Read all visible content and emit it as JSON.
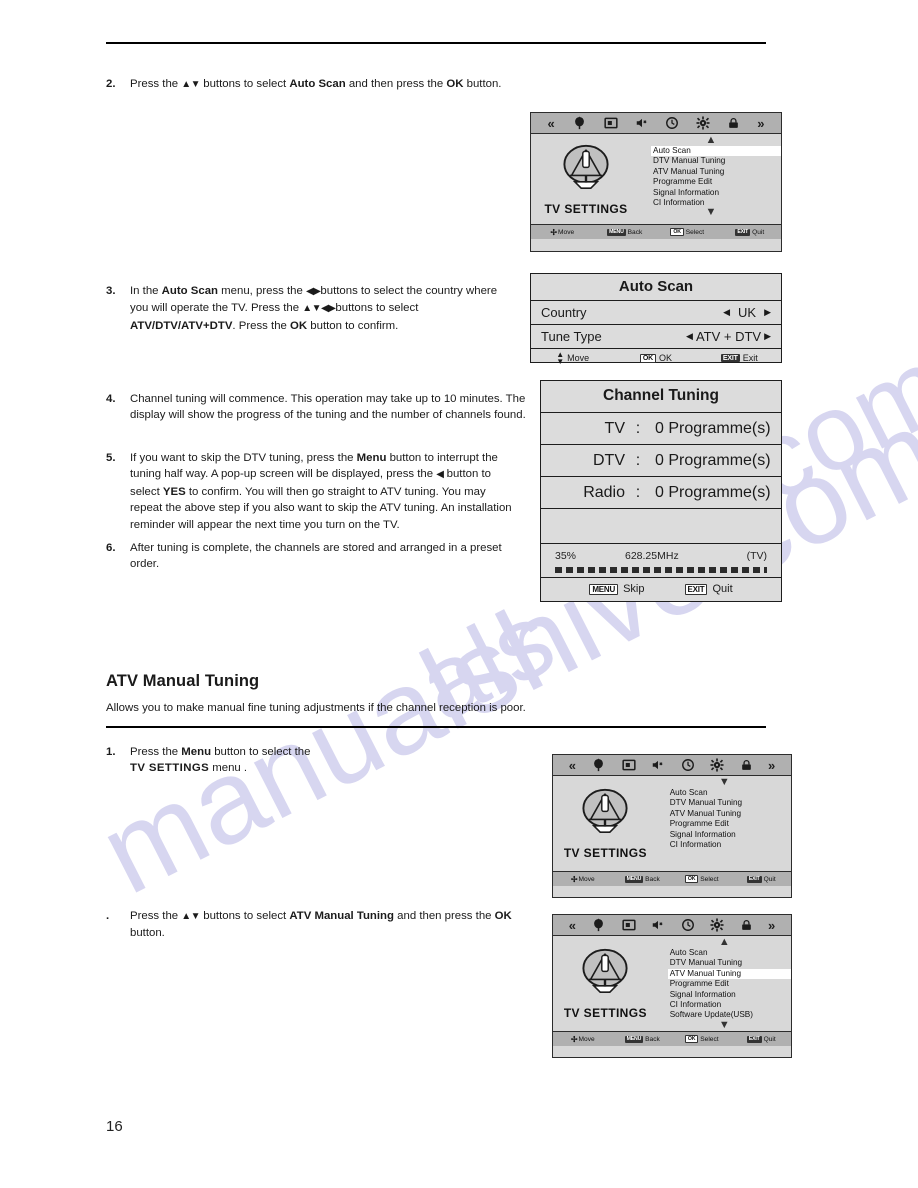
{
  "page": {
    "number": "16"
  },
  "watermark": {
    "line1": "manualshive.com",
    "line2": "ve.com",
    "line3": "als"
  },
  "steps": {
    "s2": {
      "num": "2.",
      "html_parts": {
        "p1": "Press the ",
        "arrows1": "▲▼",
        "p2": " buttons to select ",
        "b1": "Auto Scan",
        "p3": " and then press the ",
        "b2": "OK",
        "p4": " button."
      }
    },
    "s3": {
      "num": "3.",
      "html_parts": {
        "p1": "In the ",
        "b1": "Auto  Scan",
        "p2": " menu, press the ",
        "arrows1": "◀▶",
        "p3": "buttons to select the country where you will operate the TV. Press the ",
        "arrows2": "▲▼◀▶",
        "p4": "buttons to select ",
        "b2": "ATV/DTV/ATV+DTV",
        "p5": ". Press the ",
        "b3": "OK",
        "p6": " button to confirm."
      }
    },
    "s4": {
      "num": "4.",
      "text": "Channel tuning will commence. This operation may take up to 10 minutes. The display will show the progress of the tuning and the number of channels found."
    },
    "s5": {
      "num": "5.",
      "html_parts": {
        "p1": "If you want to skip the DTV tuning, press the ",
        "b1": "Menu",
        "p2": " button to interrupt the tuning half way. A pop-up screen will be displayed, press the ",
        "arrows1": "◀",
        "p3": " button to select ",
        "b2": "YES",
        "p4": " to confirm. You will then go straight to ATV tuning. You may repeat the above step if you also want to skip the ATV tuning. An installation reminder will appear the next time you turn on the TV."
      }
    },
    "s6": {
      "num": "6.",
      "text": "After tuning is complete, the channels are stored and arranged in a preset order."
    },
    "a1": {
      "num": "1.",
      "html_parts": {
        "p1": "Press the ",
        "b1": "Menu",
        "p2": " button to select the ",
        "b2": "TV SETTINGS",
        "p3": " menu ."
      }
    },
    "a2": {
      "num": ".",
      "html_parts": {
        "p1": "Press the ",
        "arrows1": "▲▼",
        "p2": " buttons to select ",
        "b1": "ATV Manual Tuning",
        "p3": " and then press the ",
        "b2": "OK",
        "p4": " button."
      }
    }
  },
  "section": {
    "title": "ATV Manual Tuning",
    "description": "Allows you to make manual fine tuning adjustments if the channel reception is poor."
  },
  "osd_common": {
    "brand": "TV SETTINGS",
    "icons": [
      "chevron-left-icon",
      "antenna-icon",
      "picture-icon",
      "sound-icon",
      "clock-icon",
      "gear-icon",
      "lock-icon",
      "chevron-right-icon"
    ],
    "chevron_left": "«",
    "chevron_right": "»",
    "chevron_up": "«",
    "chevron_down": "»",
    "footer": {
      "move": "Move",
      "menu_key": "MENU",
      "back": "Back",
      "ok_key": "OK",
      "select": "Select",
      "exit_key": "EXIT",
      "quit": "Quit"
    }
  },
  "osd1": {
    "scroll_top": "up",
    "scroll_bottom": "down",
    "items": [
      {
        "label": "Auto Scan",
        "selected": true
      },
      {
        "label": "DTV Manual Tuning",
        "selected": false
      },
      {
        "label": "ATV Manual Tuning",
        "selected": false
      },
      {
        "label": "Programme Edit",
        "selected": false
      },
      {
        "label": "Signal Information",
        "selected": false
      },
      {
        "label": "CI Information",
        "selected": false
      }
    ]
  },
  "osd2": {
    "scroll_top": "down",
    "scroll_bottom": "none",
    "items": [
      {
        "label": "Auto Scan",
        "selected": false
      },
      {
        "label": "DTV Manual Tuning",
        "selected": false
      },
      {
        "label": "ATV Manual Tuning",
        "selected": false
      },
      {
        "label": "Programme Edit",
        "selected": false
      },
      {
        "label": "Signal Information",
        "selected": false
      },
      {
        "label": "CI Information",
        "selected": false
      }
    ]
  },
  "osd3": {
    "scroll_top": "up",
    "scroll_bottom": "down",
    "items": [
      {
        "label": "Auto Scan",
        "selected": false
      },
      {
        "label": "DTV Manual Tuning",
        "selected": false
      },
      {
        "label": "ATV Manual Tuning",
        "selected": true
      },
      {
        "label": "Programme Edit",
        "selected": false
      },
      {
        "label": "Signal Information",
        "selected": false
      },
      {
        "label": "CI Information",
        "selected": false
      },
      {
        "label": "Software Update(USB)",
        "selected": false
      }
    ]
  },
  "auto_scan_panel": {
    "title": "Auto Scan",
    "rows": [
      {
        "label": "Country",
        "left_arrow": "◀",
        "value": "UK",
        "right_arrow": "▶"
      },
      {
        "label": "Tune Type",
        "left_arrow": "◀",
        "value": "ATV + DTV",
        "right_arrow": "▶"
      }
    ],
    "footer": {
      "move": "Move",
      "ok_key": "OK",
      "ok_label": "OK",
      "exit_key": "EXIT",
      "exit_label": "Exit"
    }
  },
  "channel_tuning": {
    "title": "Channel Tuning",
    "rows": [
      {
        "key": "TV",
        "colon": ":",
        "value": "0  Programme(s)"
      },
      {
        "key": "DTV",
        "colon": ":",
        "value": "0  Programme(s)"
      },
      {
        "key": "Radio",
        "colon": ":",
        "value": "0  Programme(s)"
      }
    ],
    "progress": {
      "percent": "35%",
      "frequency": "628.25MHz",
      "mode": "(TV)",
      "value": 35
    },
    "footer": {
      "menu_key": "MENU",
      "skip": "Skip",
      "exit_key": "EXIT",
      "quit": "Quit"
    }
  }
}
